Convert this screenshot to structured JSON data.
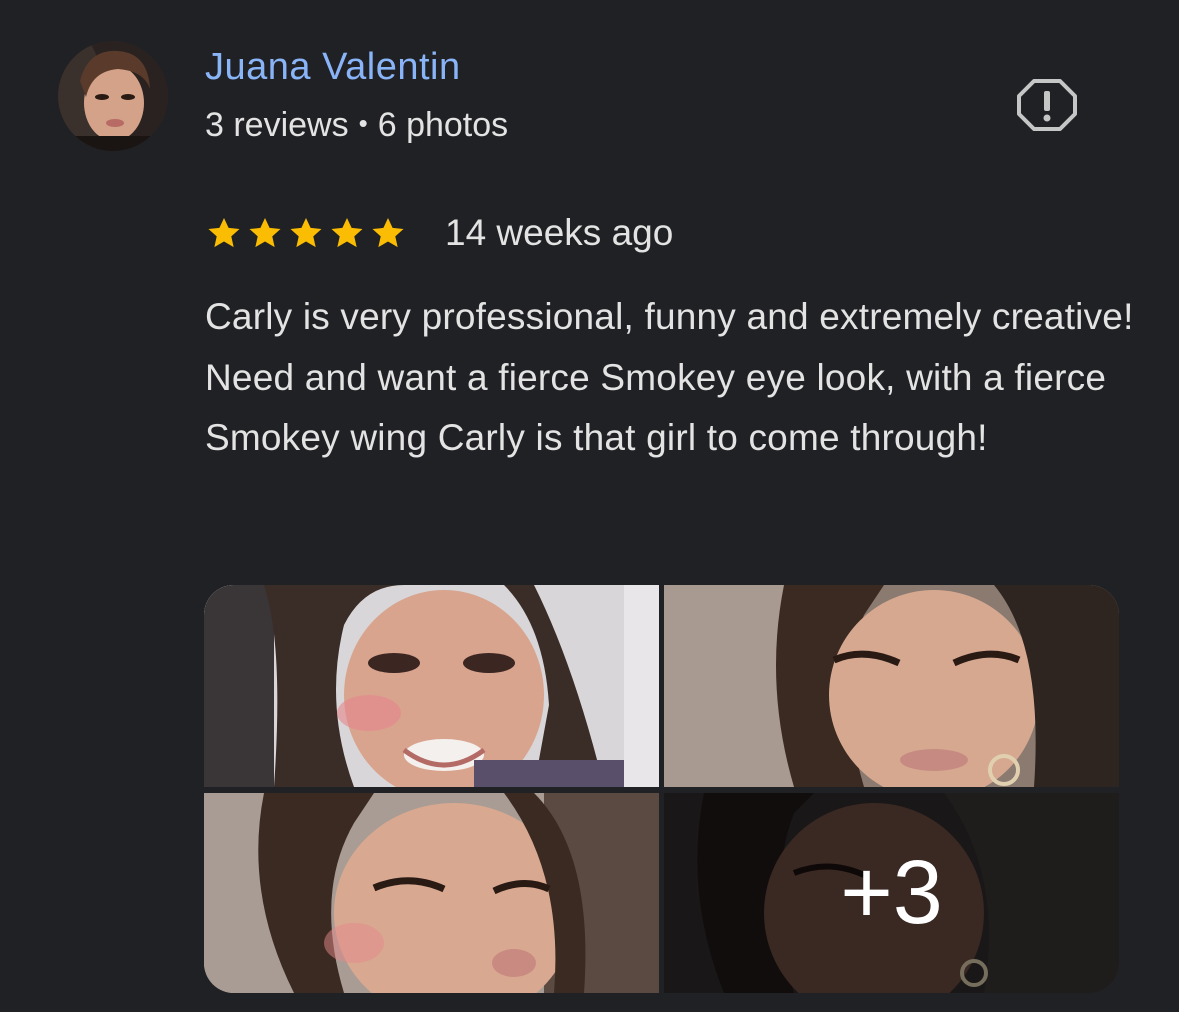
{
  "author": {
    "name": "Juana Valentin",
    "reviews_count": "3 reviews",
    "separator": "•",
    "photos_count": "6 photos"
  },
  "report_icon": "report-flag-icon",
  "rating": {
    "stars": 5,
    "max_stars": 5,
    "star_color": "#fbbc04",
    "time_ago": "14 weeks ago"
  },
  "review": {
    "text": "Carly is very professional, funny and extremely creative! Need and want a fierce Smokey eye look, with a fierce Smokey wing Carly is that girl to come through!"
  },
  "photos": {
    "more_label": "+3"
  },
  "colors": {
    "background": "#202124",
    "name": "#8ab4f8",
    "text": "#e3e3e3",
    "star": "#fbbc04"
  }
}
